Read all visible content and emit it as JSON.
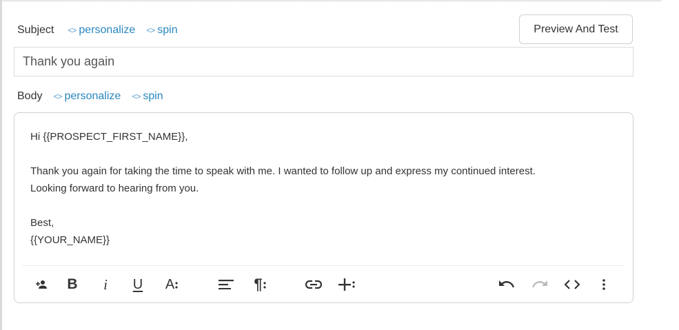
{
  "subject": {
    "label": "Subject",
    "personalize_label": "personalize",
    "spin_label": "spin",
    "value": "Thank you again"
  },
  "preview_button": {
    "label": "Preview And Test"
  },
  "body": {
    "label": "Body",
    "personalize_label": "personalize",
    "spin_label": "spin",
    "lines": [
      "Hi {{PROSPECT_FIRST_NAME}},",
      "",
      "Thank you again for taking the time to speak with me. I wanted to follow up and express my continued interest.",
      "Looking forward to hearing from you.",
      "",
      "Best,",
      "{{YOUR_NAME}}"
    ]
  },
  "toolbar": {
    "icons": [
      "person-add-icon",
      "bold-icon",
      "italic-icon",
      "underline-icon",
      "font-size-icon",
      "align-icon",
      "paragraph-icon",
      "link-icon",
      "insert-icon",
      "undo-icon",
      "redo-icon",
      "code-view-icon",
      "more-icon"
    ],
    "bold_glyph": "B",
    "italic_glyph": "i",
    "underline_glyph": "U",
    "font_glyph": "A",
    "paragraph_glyph": "¶"
  },
  "colors": {
    "link": "#2a87c0",
    "border": "#cfcfcf",
    "text": "#333333",
    "disabled": "#bbbbbb"
  }
}
